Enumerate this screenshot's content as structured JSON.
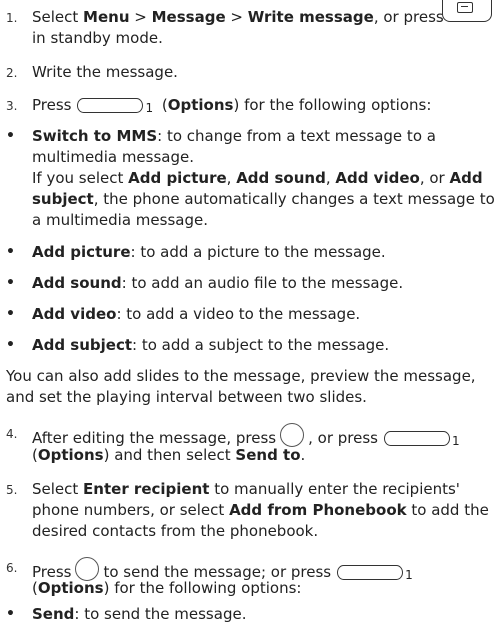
{
  "steps": {
    "s1": {
      "num": "1.",
      "pre": "Select ",
      "menu": "Menu",
      "gt1": " > ",
      "message": "Message",
      "gt2": " > ",
      "write": "Write message",
      "post": ", or press",
      "line2": "in standby mode."
    },
    "s2": {
      "num": "2.",
      "text": "Write the message."
    },
    "s3": {
      "num": "3.",
      "pre": "Press",
      "sub": "1",
      "open": " (",
      "options": "Options",
      "post": ") for the following options:"
    },
    "s4": {
      "num": "4.",
      "pre": "After editing the message, press",
      "mid": ", or press",
      "sub": "1",
      "l2open": "(",
      "options": "Options",
      "l2mid": ") and then select ",
      "sendto": "Send to",
      "l2end": "."
    },
    "s5": {
      "num": "5.",
      "pre": "Select ",
      "enter": "Enter recipient",
      "mid": " to manually enter the recipients'",
      "l2pre": "phone numbers, or select ",
      "addpb": "Add from Phonebook",
      "l2post": " to add the",
      "l3": "desired contacts from the phonebook."
    },
    "s6": {
      "num": "6.",
      "pre": "Press",
      "mid": "to send the message; or press",
      "sub": "1",
      "l2open": "(",
      "options": "Options",
      "l2post": ") for the following options:"
    }
  },
  "bullet": "•",
  "options": {
    "mms": {
      "label": "Switch to MMS",
      "l1": ": to change from a text message to a",
      "l2": "multimedia message."
    },
    "mms_note": {
      "l1pre": "If you select ",
      "a": "Add picture",
      "c1": ", ",
      "b": "Add sound",
      "c2": ", ",
      "c": "Add video",
      "c3": ", or ",
      "d": "Add",
      "l2bold": "subject",
      "l2rest": ", the phone automatically changes a text message to",
      "l3": "a multimedia message."
    },
    "picture": {
      "label": "Add picture",
      "text": ": to add a picture to the message."
    },
    "sound": {
      "label": "Add sound",
      "text": ": to add an audio file to the message."
    },
    "video": {
      "label": "Add video",
      "text": ": to add a video to the message."
    },
    "subject": {
      "label": "Add subject",
      "text": ": to add a subject to the message."
    },
    "send": {
      "label": "Send",
      "text": ": to send the message."
    }
  },
  "slides_note": {
    "l1": "You can also add slides to the message, preview the message,",
    "l2": "and set the playing interval between two slides."
  },
  "icons": {
    "message_key": "message-key-icon",
    "soft_key": "left-soft-key-icon",
    "ok_key": "confirm-key-icon"
  }
}
